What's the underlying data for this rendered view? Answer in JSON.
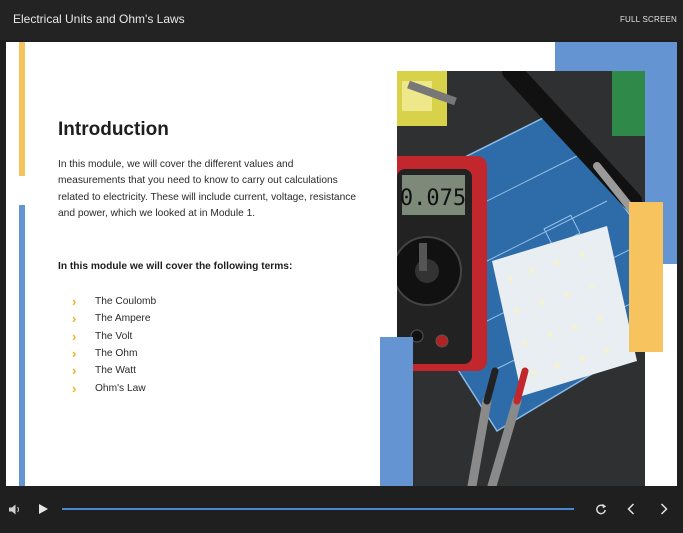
{
  "app": {
    "title": "Electrical Units and Ohm's Laws",
    "fullscreen_label": "FULL SCREEN"
  },
  "slide": {
    "heading": "Introduction",
    "paragraph": "In this module, we will cover the different values and measurements that you need to know to carry out calculations related to electricity. These will include current, voltage, resistance and power, which we looked at in Module 1.",
    "subheading": "In this module we will cover the following terms:",
    "terms": [
      "The Coulomb",
      "The Ampere",
      "The Volt",
      "The Ohm",
      "The Watt",
      "Ohm's Law"
    ],
    "meter_display": "0.075"
  },
  "colors": {
    "accent_yellow": "#f6c35f",
    "accent_blue": "#6494d1",
    "chevron": "#f2b318",
    "progress": "#4a88d8"
  },
  "controls": {
    "icons": [
      "volume-icon",
      "play-icon",
      "replay-icon",
      "prev-icon",
      "next-icon"
    ]
  }
}
